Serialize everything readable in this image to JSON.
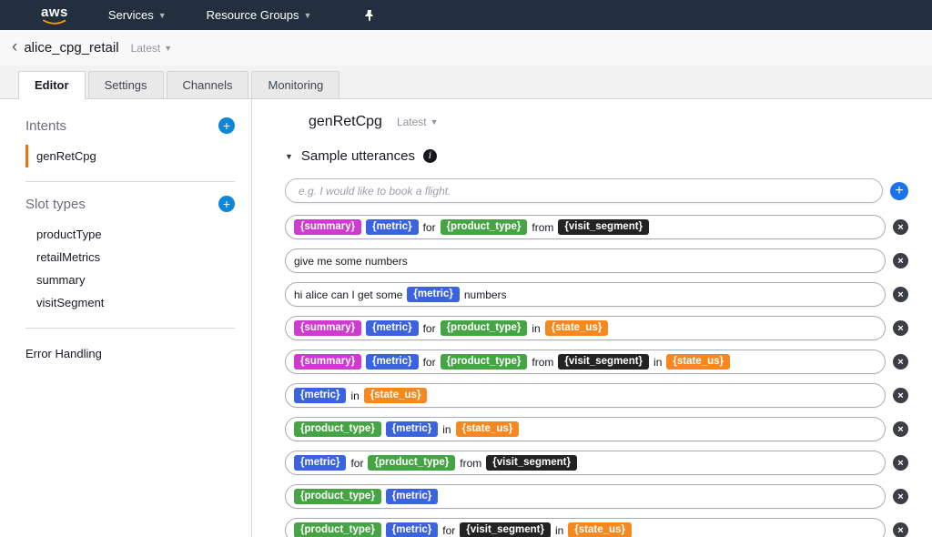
{
  "topnav": {
    "logo_text": "aws",
    "services_label": "Services",
    "resource_groups_label": "Resource Groups"
  },
  "header": {
    "back_icon": "‹",
    "title": "alice_cpg_retail",
    "version_label": "Latest"
  },
  "tabs": [
    {
      "label": "Editor",
      "active": true
    },
    {
      "label": "Settings",
      "active": false
    },
    {
      "label": "Channels",
      "active": false
    },
    {
      "label": "Monitoring",
      "active": false
    }
  ],
  "sidebar": {
    "intents": {
      "label": "Intents",
      "items": [
        {
          "label": "genRetCpg",
          "selected": true
        }
      ]
    },
    "slot_types": {
      "label": "Slot types",
      "items": [
        "productType",
        "retailMetrics",
        "summary",
        "visitSegment"
      ]
    },
    "error_handling_label": "Error Handling"
  },
  "main": {
    "intent_name": "genRetCpg",
    "version_label": "Latest",
    "section_title": "Sample utterances",
    "input_placeholder": "e.g. I would like to book a flight.",
    "utterances": [
      {
        "parts": [
          {
            "type": "slot",
            "label": "{summary}",
            "slot": "summary"
          },
          {
            "type": "slot",
            "label": "{metric}",
            "slot": "metric"
          },
          {
            "type": "text",
            "label": "for"
          },
          {
            "type": "slot",
            "label": "{product_type}",
            "slot": "product_type"
          },
          {
            "type": "text",
            "label": "from"
          },
          {
            "type": "slot",
            "label": "{visit_segment}",
            "slot": "visit_segment"
          }
        ]
      },
      {
        "parts": [
          {
            "type": "text",
            "label": "give me some numbers"
          }
        ]
      },
      {
        "parts": [
          {
            "type": "text",
            "label": "hi alice can I get some"
          },
          {
            "type": "slot",
            "label": "{metric}",
            "slot": "metric"
          },
          {
            "type": "text",
            "label": "numbers"
          }
        ]
      },
      {
        "parts": [
          {
            "type": "slot",
            "label": "{summary}",
            "slot": "summary"
          },
          {
            "type": "slot",
            "label": "{metric}",
            "slot": "metric"
          },
          {
            "type": "text",
            "label": "for"
          },
          {
            "type": "slot",
            "label": "{product_type}",
            "slot": "product_type"
          },
          {
            "type": "text",
            "label": "in"
          },
          {
            "type": "slot",
            "label": "{state_us}",
            "slot": "state_us"
          }
        ]
      },
      {
        "parts": [
          {
            "type": "slot",
            "label": "{summary}",
            "slot": "summary"
          },
          {
            "type": "slot",
            "label": "{metric}",
            "slot": "metric"
          },
          {
            "type": "text",
            "label": "for"
          },
          {
            "type": "slot",
            "label": "{product_type}",
            "slot": "product_type"
          },
          {
            "type": "text",
            "label": "from"
          },
          {
            "type": "slot",
            "label": "{visit_segment}",
            "slot": "visit_segment"
          },
          {
            "type": "text",
            "label": "in"
          },
          {
            "type": "slot",
            "label": "{state_us}",
            "slot": "state_us"
          }
        ]
      },
      {
        "parts": [
          {
            "type": "slot",
            "label": "{metric}",
            "slot": "metric"
          },
          {
            "type": "text",
            "label": "in"
          },
          {
            "type": "slot",
            "label": "{state_us}",
            "slot": "state_us"
          }
        ]
      },
      {
        "parts": [
          {
            "type": "slot",
            "label": "{product_type}",
            "slot": "product_type"
          },
          {
            "type": "slot",
            "label": "{metric}",
            "slot": "metric"
          },
          {
            "type": "text",
            "label": "in"
          },
          {
            "type": "slot",
            "label": "{state_us}",
            "slot": "state_us"
          }
        ]
      },
      {
        "parts": [
          {
            "type": "slot",
            "label": "{metric}",
            "slot": "metric"
          },
          {
            "type": "text",
            "label": "for"
          },
          {
            "type": "slot",
            "label": "{product_type}",
            "slot": "product_type"
          },
          {
            "type": "text",
            "label": "from"
          },
          {
            "type": "slot",
            "label": "{visit_segment}",
            "slot": "visit_segment"
          }
        ]
      },
      {
        "parts": [
          {
            "type": "slot",
            "label": "{product_type}",
            "slot": "product_type"
          },
          {
            "type": "slot",
            "label": "{metric}",
            "slot": "metric"
          }
        ]
      },
      {
        "parts": [
          {
            "type": "slot",
            "label": "{product_type}",
            "slot": "product_type"
          },
          {
            "type": "slot",
            "label": "{metric}",
            "slot": "metric"
          },
          {
            "type": "text",
            "label": "for"
          },
          {
            "type": "slot",
            "label": "{visit_segment}",
            "slot": "visit_segment"
          },
          {
            "type": "text",
            "label": "in"
          },
          {
            "type": "slot",
            "label": "{state_us}",
            "slot": "state_us"
          }
        ]
      }
    ]
  },
  "slot_colors": {
    "summary": "#cf3acf",
    "metric": "#3b63e0",
    "product_type": "#45a545",
    "visit_segment": "#232323",
    "state_us": "#f6881f"
  },
  "accent_colors": {
    "navbar_bg": "#232f3e",
    "selected_intent_border": "#ec7211",
    "add_button_blue": "#1a73e8",
    "sidebar_plus_blue": "#0f86d8",
    "aws_smile_orange": "#ff9900"
  }
}
